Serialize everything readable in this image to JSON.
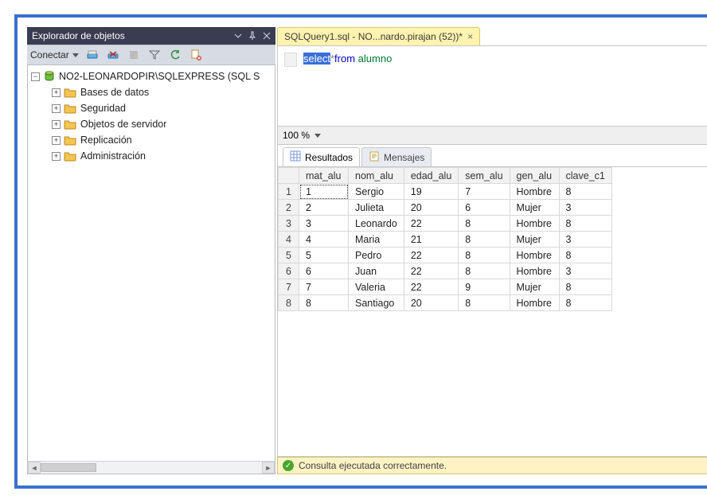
{
  "left_panel": {
    "title": "Explorador de objetos",
    "toolbar": {
      "connect_label": "Conectar"
    },
    "tree": {
      "root_label": "NO2-LEONARDOPIR\\SQLEXPRESS (SQL S",
      "children": [
        {
          "label": "Bases de datos"
        },
        {
          "label": "Seguridad"
        },
        {
          "label": "Objetos de servidor"
        },
        {
          "label": "Replicación"
        },
        {
          "label": "Administración"
        }
      ]
    }
  },
  "tabs": {
    "active": {
      "label": "SQLQuery1.sql - NO...nardo.pirajan (52))*"
    }
  },
  "editor": {
    "line_tokens": [
      {
        "t": "select",
        "cls": "kw sel"
      },
      {
        "t": "*",
        "cls": "op"
      },
      {
        "t": "from ",
        "cls": "kw"
      },
      {
        "t": "alumno",
        "cls": "name"
      }
    ]
  },
  "zoom": {
    "value": "100 %"
  },
  "result_tabs": {
    "results_label": "Resultados",
    "messages_label": "Mensajes"
  },
  "results": {
    "columns": [
      "mat_alu",
      "nom_alu",
      "edad_alu",
      "sem_alu",
      "gen_alu",
      "clave_c1"
    ],
    "rows": [
      [
        "1",
        "Sergio",
        "19",
        "7",
        "Hombre",
        "8"
      ],
      [
        "2",
        "Julieta",
        "20",
        "6",
        "Mujer",
        "3"
      ],
      [
        "3",
        "Leonardo",
        "22",
        "8",
        "Hombre",
        "8"
      ],
      [
        "4",
        "Maria",
        "21",
        "8",
        "Mujer",
        "3"
      ],
      [
        "5",
        "Pedro",
        "22",
        "8",
        "Hombre",
        "8"
      ],
      [
        "6",
        "Juan",
        "22",
        "8",
        "Hombre",
        "3"
      ],
      [
        "7",
        "Valeria",
        "22",
        "9",
        "Mujer",
        "8"
      ],
      [
        "8",
        "Santiago",
        "20",
        "8",
        "Hombre",
        "8"
      ]
    ]
  },
  "status": {
    "message": "Consulta ejecutada correctamente."
  }
}
